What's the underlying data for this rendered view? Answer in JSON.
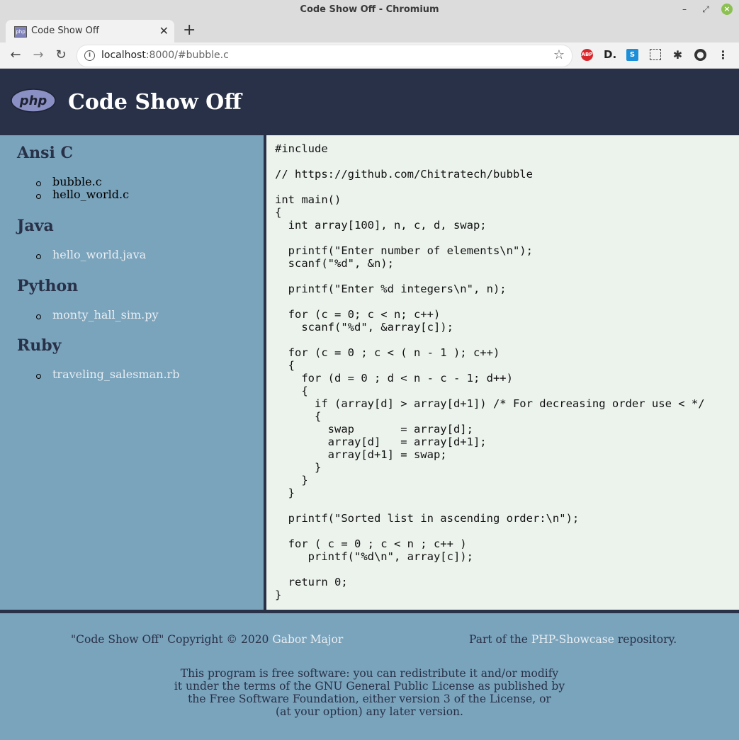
{
  "window": {
    "title": "Code Show Off - Chromium"
  },
  "tab": {
    "title": "Code Show Off"
  },
  "address_bar": {
    "url_host": "localhost",
    "url_rest": ":8000/#bubble.c"
  },
  "header": {
    "logo_text": "php",
    "title": "Code Show Off"
  },
  "sidebar": {
    "sections": [
      {
        "heading": "Ansi C",
        "files": [
          "bubble.c",
          "hello_world.c"
        ]
      },
      {
        "heading": "Java",
        "files": [
          "hello_world.java"
        ]
      },
      {
        "heading": "Python",
        "files": [
          "monty_hall_sim.py"
        ]
      },
      {
        "heading": "Ruby",
        "files": [
          "traveling_salesman.rb"
        ]
      }
    ]
  },
  "code": "#include\n\n// https://github.com/Chitratech/bubble\n\nint main()\n{\n  int array[100], n, c, d, swap;\n\n  printf(\"Enter number of elements\\n\");\n  scanf(\"%d\", &n);\n\n  printf(\"Enter %d integers\\n\", n);\n\n  for (c = 0; c < n; c++)\n    scanf(\"%d\", &array[c]);\n\n  for (c = 0 ; c < ( n - 1 ); c++)\n  {\n    for (d = 0 ; d < n - c - 1; d++)\n    {\n      if (array[d] > array[d+1]) /* For decreasing order use < */\n      {\n        swap       = array[d];\n        array[d]   = array[d+1];\n        array[d+1] = swap;\n      }\n    }\n  }\n\n  printf(\"Sorted list in ascending order:\\n\");\n\n  for ( c = 0 ; c < n ; c++ )\n     printf(\"%d\\n\", array[c]);\n\n  return 0;\n}",
  "footer": {
    "copyright_prefix": "\"Code Show Off\" Copyright © 2020",
    "author": "Gabor Major",
    "part_prefix": "Part of the",
    "repo": "PHP-Showcase",
    "part_suffix": "repository.",
    "license_lines": [
      "This program is free software: you can redistribute it and/or modify",
      "it under the terms of the GNU General Public License as published by",
      "the Free Software Foundation, either version 3 of the License, or",
      "(at your option) any later version."
    ]
  }
}
